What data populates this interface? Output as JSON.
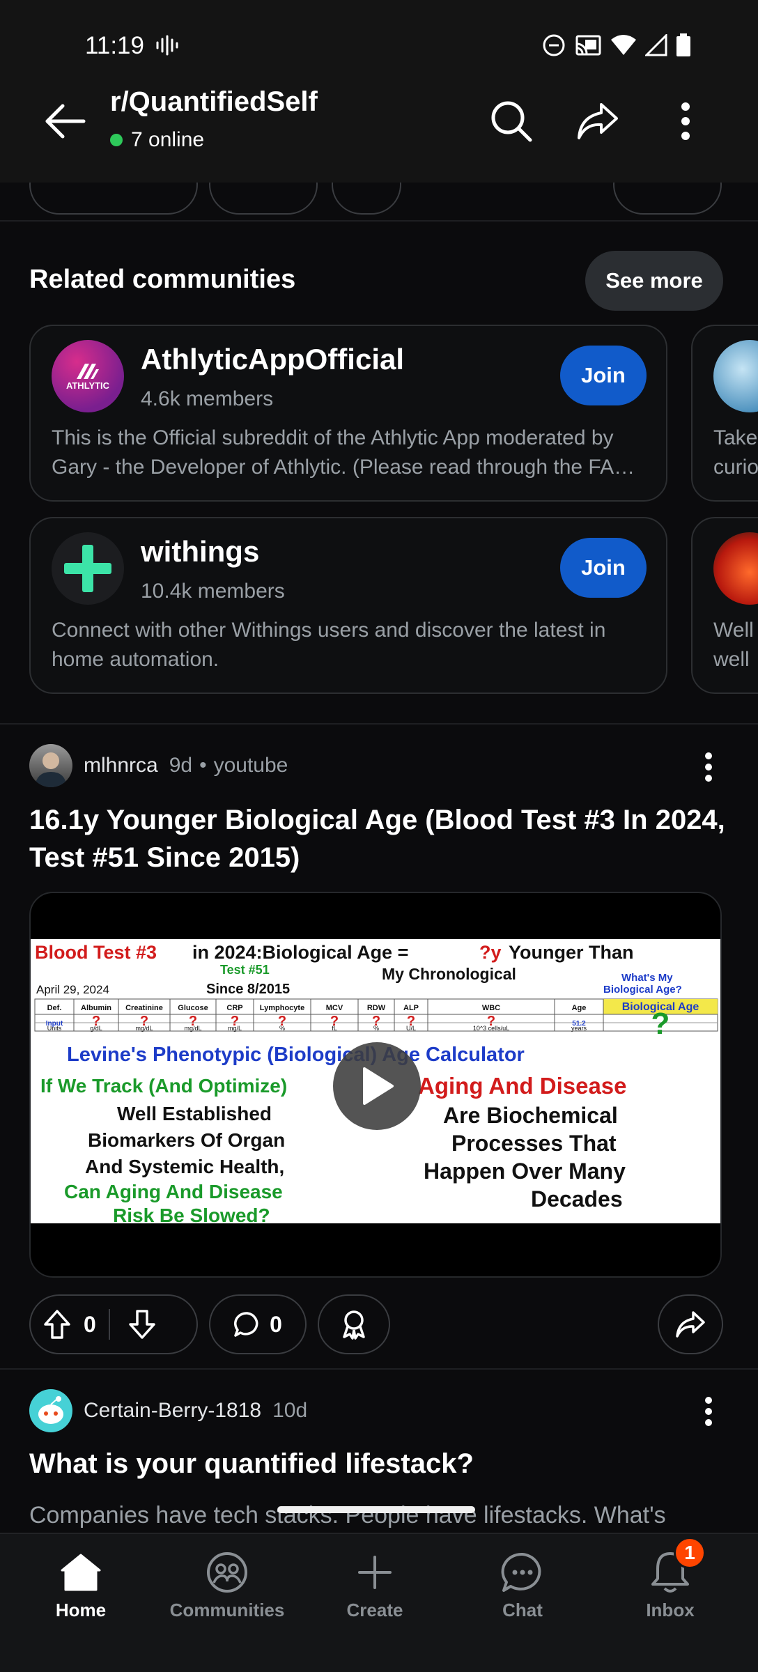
{
  "status_bar": {
    "time": "11:19"
  },
  "header": {
    "subreddit": "r/QuantifiedSelf",
    "online": "7 online"
  },
  "related": {
    "title": "Related communities",
    "see_more": "See more",
    "cards": [
      {
        "name": "AthlyticAppOfficial",
        "members": "4.6k members",
        "join": "Join",
        "avatar_text": "ATHLYTIC",
        "description": "This is the Official subreddit of the Athlytic App moderated by Gary - the Developer of Athlytic.  (Please read through the FA…"
      },
      {
        "name": "withings",
        "members": "10.4k members",
        "join": "Join",
        "description": "Connect with other Withings users and discover the latest in home automation."
      }
    ],
    "peek_cards": [
      {
        "line1": "Take",
        "line2": "curio"
      },
      {
        "line1": "Well",
        "line2": "well"
      }
    ]
  },
  "posts": [
    {
      "author": "mlhnrca",
      "age": "9d",
      "separator": "•",
      "source": "youtube",
      "title": "16.1y Younger Biological Age (Blood Test #3 In 2024, Test #51 Since 2015)",
      "upvotes": "0",
      "comments": "0",
      "thumbnail": {
        "heading_red": "Blood Test #3",
        "heading_black": " in 2024:Biological Age = ",
        "heading_q": "?y",
        "heading_tail": " Younger Than",
        "chronological": "My Chronological",
        "test_no": "Test #51",
        "date": "April 29, 2024",
        "since": "Since 8/2015",
        "whats_my": "What's My",
        "bio_age_q": "Biological Age?",
        "table_headers": [
          "Def.",
          "Albumin",
          "Creatinine",
          "Glucose",
          "CRP",
          "Lymphocyte",
          "MCV",
          "RDW",
          "ALP",
          "WBC",
          "Age",
          "Biological Age"
        ],
        "table_row1": [
          "Input",
          "?",
          "?",
          "?",
          "?",
          "?",
          "?",
          "?",
          "?",
          "?",
          "51.2",
          "?"
        ],
        "table_row2": [
          "Units",
          "g/dL",
          "mg/dL",
          "mg/dL",
          "mg/L",
          "%",
          "fL",
          "%",
          "U/L",
          "10^3 cells/uL",
          "years",
          ""
        ],
        "calculator": "Levine's Phenotypic (Biological) Age Calculator",
        "left_green1": "If We Track (And Optimize)",
        "left_black1": "Well Established",
        "left_black2": "Biomarkers Of Organ",
        "left_black3": "And Systemic Health,",
        "left_green2": "Can Aging And Disease",
        "left_green3": "Risk Be Slowed?",
        "right_red": "Aging And Disease",
        "right_black1": "Are Biochemical",
        "right_black2": "Processes That",
        "right_black3": "Happen Over Many",
        "right_black4": "Decades"
      }
    },
    {
      "author": "Certain-Berry-1818",
      "age": "10d",
      "title": "What is your quantified lifestack?",
      "body": "Companies have tech stacks. People have lifestacks. What's"
    }
  ],
  "bottom_nav": {
    "items": [
      {
        "label": "Home",
        "icon": "home-icon",
        "active": true
      },
      {
        "label": "Communities",
        "icon": "communities-icon"
      },
      {
        "label": "Create",
        "icon": "plus-icon"
      },
      {
        "label": "Chat",
        "icon": "chat-icon"
      },
      {
        "label": "Inbox",
        "icon": "bell-icon",
        "badge": "1"
      }
    ]
  },
  "colors": {
    "accent": "#115bca",
    "badge": "#ff4500",
    "online": "#2ec95a",
    "background": "#0b0b0d"
  }
}
